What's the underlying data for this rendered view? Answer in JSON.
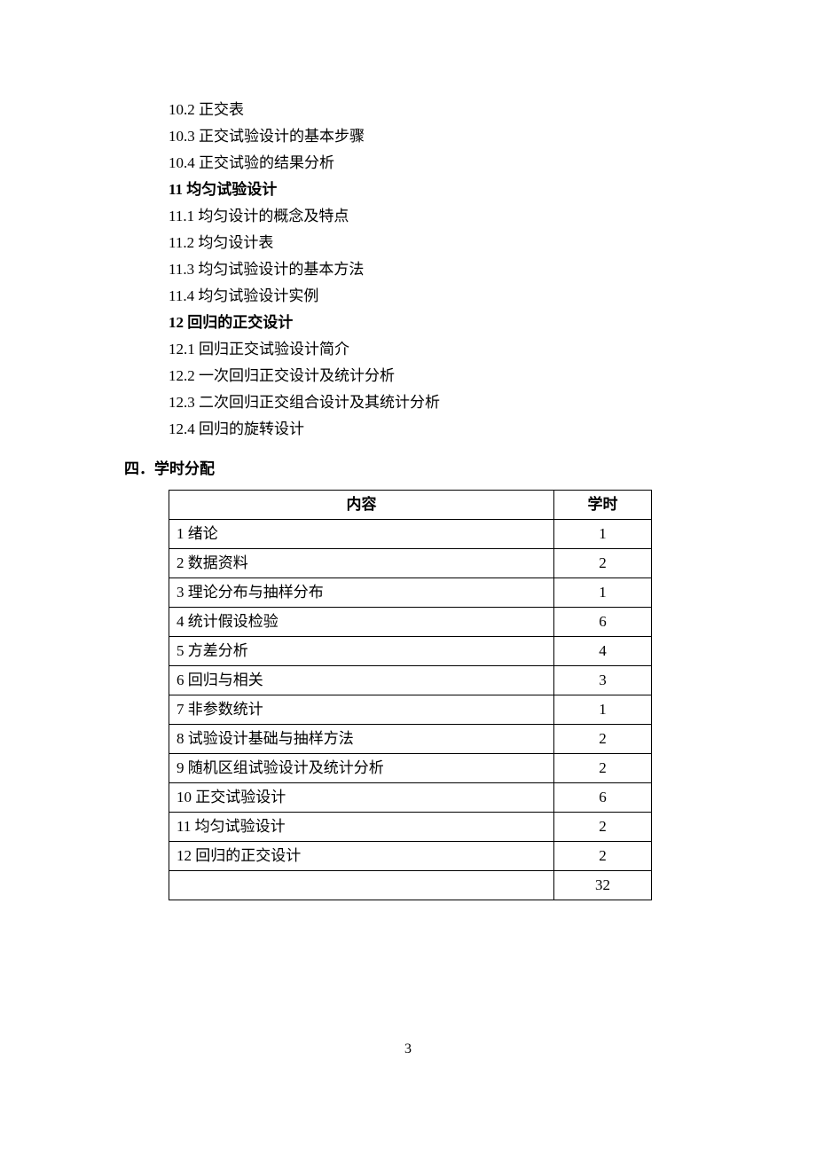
{
  "lines": [
    {
      "text": "10.2 正交表",
      "bold": false
    },
    {
      "text": "10.3 正交试验设计的基本步骤",
      "bold": false
    },
    {
      "text": "10.4 正交试验的结果分析",
      "bold": false
    },
    {
      "text": "11 均匀试验设计",
      "bold": true
    },
    {
      "text": "11.1 均匀设计的概念及特点",
      "bold": false
    },
    {
      "text": "11.2 均匀设计表",
      "bold": false
    },
    {
      "text": "11.3 均匀试验设计的基本方法",
      "bold": false
    },
    {
      "text": "11.4 均匀试验设计实例",
      "bold": false
    },
    {
      "text": "12 回归的正交设计",
      "bold": true
    },
    {
      "text": "12.1 回归正交试验设计简介",
      "bold": false
    },
    {
      "text": "12.2 一次回归正交设计及统计分析",
      "bold": false
    },
    {
      "text": "12.3 二次回归正交组合设计及其统计分析",
      "bold": false
    },
    {
      "text": "12.4 回归的旋转设计",
      "bold": false
    }
  ],
  "section_heading": "四．学时分配",
  "table": {
    "headers": {
      "content": "内容",
      "hours": "学时"
    },
    "rows": [
      {
        "content": "1 绪论",
        "hours": "1"
      },
      {
        "content": "2 数据资料",
        "hours": "2"
      },
      {
        "content": "3 理论分布与抽样分布",
        "hours": "1"
      },
      {
        "content": "4 统计假设检验",
        "hours": "6"
      },
      {
        "content": "5 方差分析",
        "hours": "4"
      },
      {
        "content": "6 回归与相关",
        "hours": "3"
      },
      {
        "content": "7 非参数统计",
        "hours": "1"
      },
      {
        "content": "8 试验设计基础与抽样方法",
        "hours": "2"
      },
      {
        "content": "9 随机区组试验设计及统计分析",
        "hours": "2"
      },
      {
        "content": "10 正交试验设计",
        "hours": "6"
      },
      {
        "content": "11 均匀试验设计",
        "hours": "2"
      },
      {
        "content": "12 回归的正交设计",
        "hours": "2"
      },
      {
        "content": "",
        "hours": "32"
      }
    ]
  },
  "page_number": "3"
}
